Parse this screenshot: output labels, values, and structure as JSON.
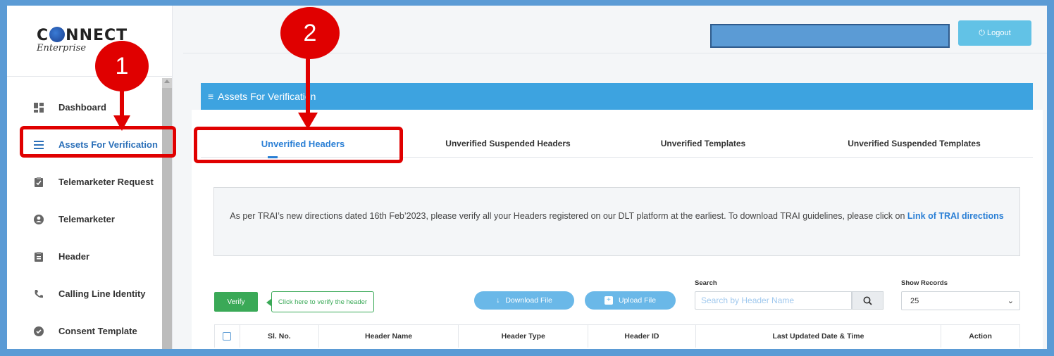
{
  "logo": {
    "brand_pre": "C",
    "brand_post": "NNECT",
    "tagline": "Enterprise"
  },
  "sidebar": {
    "items": [
      {
        "label": "Dashboard",
        "icon": "dashboard-icon"
      },
      {
        "label": "Assets For Verification",
        "icon": "list-icon",
        "active": true
      },
      {
        "label": "Telemarketer Request",
        "icon": "clipboard-check-icon"
      },
      {
        "label": "Telemarketer",
        "icon": "user-circle-icon"
      },
      {
        "label": "Header",
        "icon": "clipboard-icon"
      },
      {
        "label": "Calling Line Identity",
        "icon": "phone-icon"
      },
      {
        "label": "Consent Template",
        "icon": "check-circle-icon"
      }
    ]
  },
  "topbar": {
    "logout_label": "Logout"
  },
  "panel": {
    "title": "Assets For Verification"
  },
  "tabs": [
    {
      "label": "Unverified Headers",
      "active": true
    },
    {
      "label": "Unverified Suspended Headers"
    },
    {
      "label": "Unverified Templates"
    },
    {
      "label": "Unverified Suspended Templates"
    }
  ],
  "notice": {
    "text": "As per TRAI’s new directions dated 16th Feb’2023, please verify all your Headers registered on our DLT platform at the earliest. To download TRAI guidelines, please click on ",
    "link": "Link of TRAI directions"
  },
  "actions": {
    "verify_label": "Verify",
    "verify_tip": "Click here to verify the header",
    "download_label": "Download File",
    "upload_label": "Upload File"
  },
  "search": {
    "label": "Search",
    "placeholder": "Search by Header Name"
  },
  "records": {
    "label": "Show Records",
    "value": "25"
  },
  "table": {
    "columns": [
      "Sl. No.",
      "Header Name",
      "Header Type",
      "Header ID",
      "Last Updated Date & Time",
      "Action"
    ]
  },
  "annotations": {
    "callout_1": "1",
    "callout_2": "2"
  },
  "colors": {
    "accent": "#3da3e0",
    "annotation": "#e00000",
    "verify": "#3aa957",
    "frame": "#5b9bd5"
  }
}
